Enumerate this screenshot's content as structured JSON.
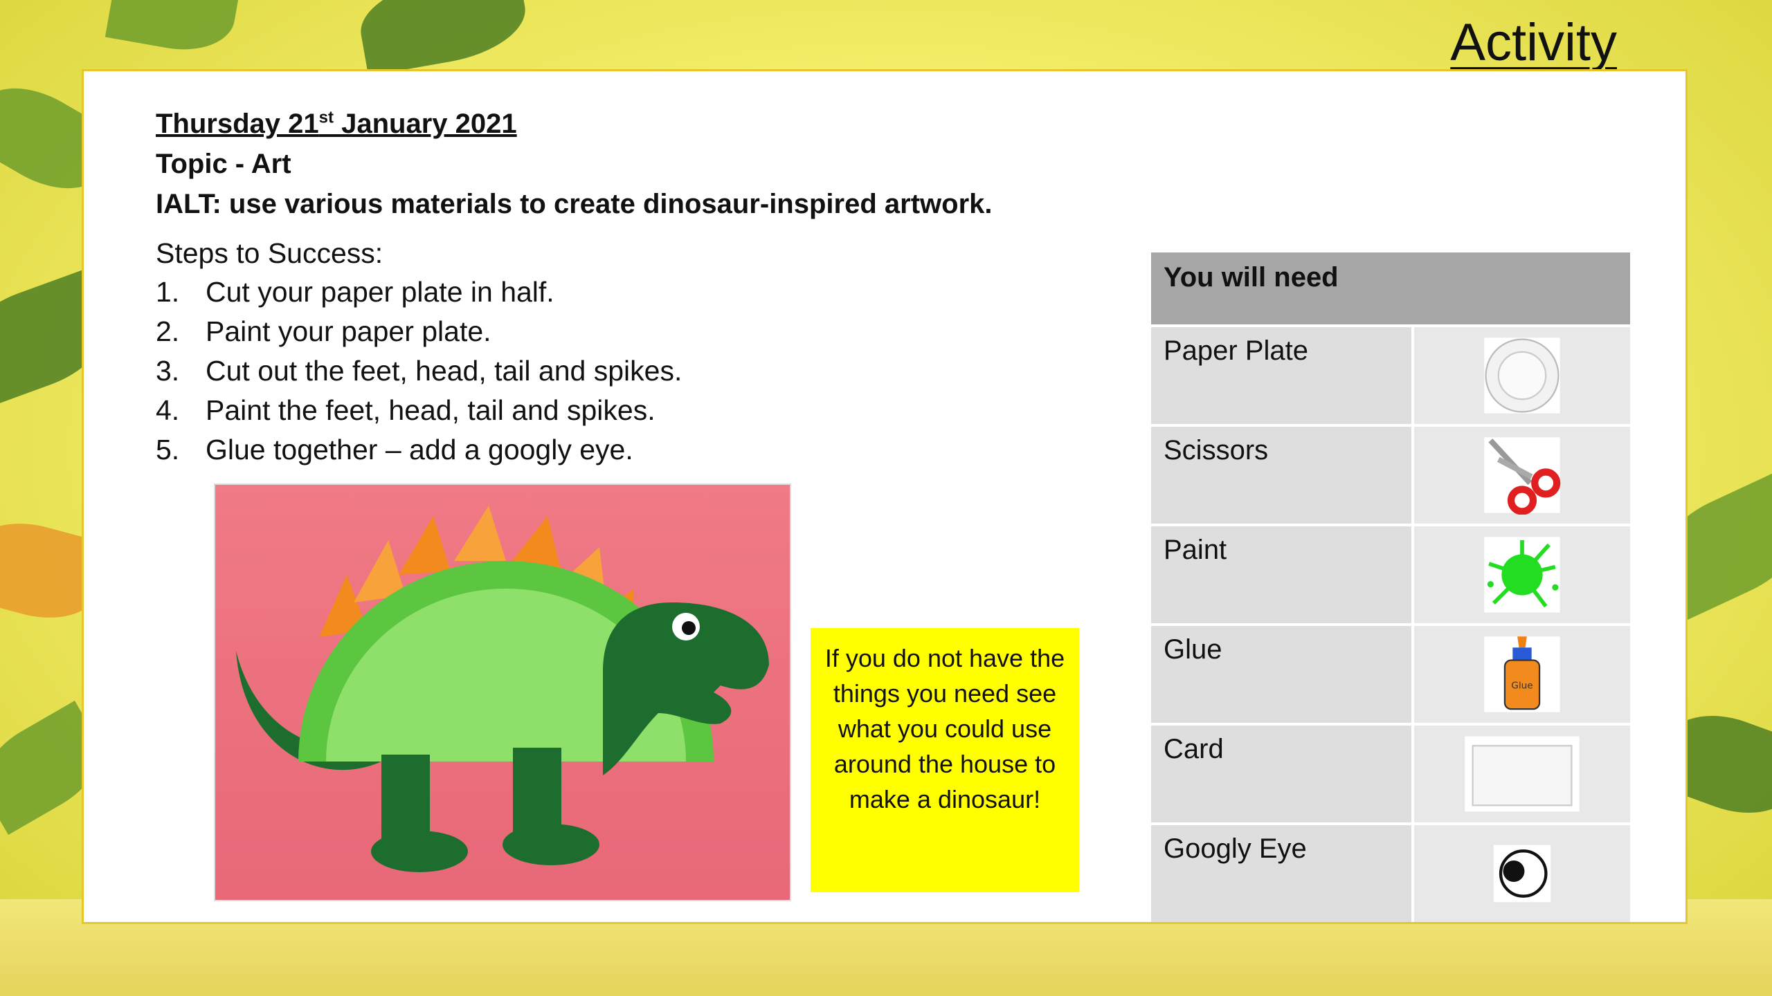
{
  "header": {
    "corner_title": "Activity",
    "date_main": "Thursday 21",
    "date_sup": "st",
    "date_rest": " January 2021",
    "topic": "Topic - Art",
    "ialt": "IALT: use various materials to create dinosaur-inspired artwork."
  },
  "steps": {
    "title": "Steps to Success:",
    "items": [
      {
        "num": "1.",
        "text": "Cut your paper plate in half."
      },
      {
        "num": "2.",
        "text": "Paint your paper plate."
      },
      {
        "num": "3.",
        "text": "Cut out the feet, head, tail and spikes."
      },
      {
        "num": "4.",
        "text": "Paint the feet, head, tail and spikes."
      },
      {
        "num": "5.",
        "text": "Glue together – add a googly eye."
      }
    ]
  },
  "note": "If you do not have the things you need see what you could use around the house to make a dinosaur!",
  "materials": {
    "header": "You will need",
    "items": [
      {
        "name": "Paper Plate",
        "icon": "paper-plate-icon"
      },
      {
        "name": "Scissors",
        "icon": "scissors-icon"
      },
      {
        "name": "Paint",
        "icon": "paint-splat-icon"
      },
      {
        "name": "Glue",
        "icon": "glue-bottle-icon"
      },
      {
        "name": "Card",
        "icon": "card-icon"
      },
      {
        "name": "Googly Eye",
        "icon": "googly-eye-icon"
      }
    ]
  },
  "glue_label": "Glue",
  "colors": {
    "note_bg": "#ffff00",
    "table_header": "#a6a6a6",
    "card_border": "#e6c62a"
  }
}
